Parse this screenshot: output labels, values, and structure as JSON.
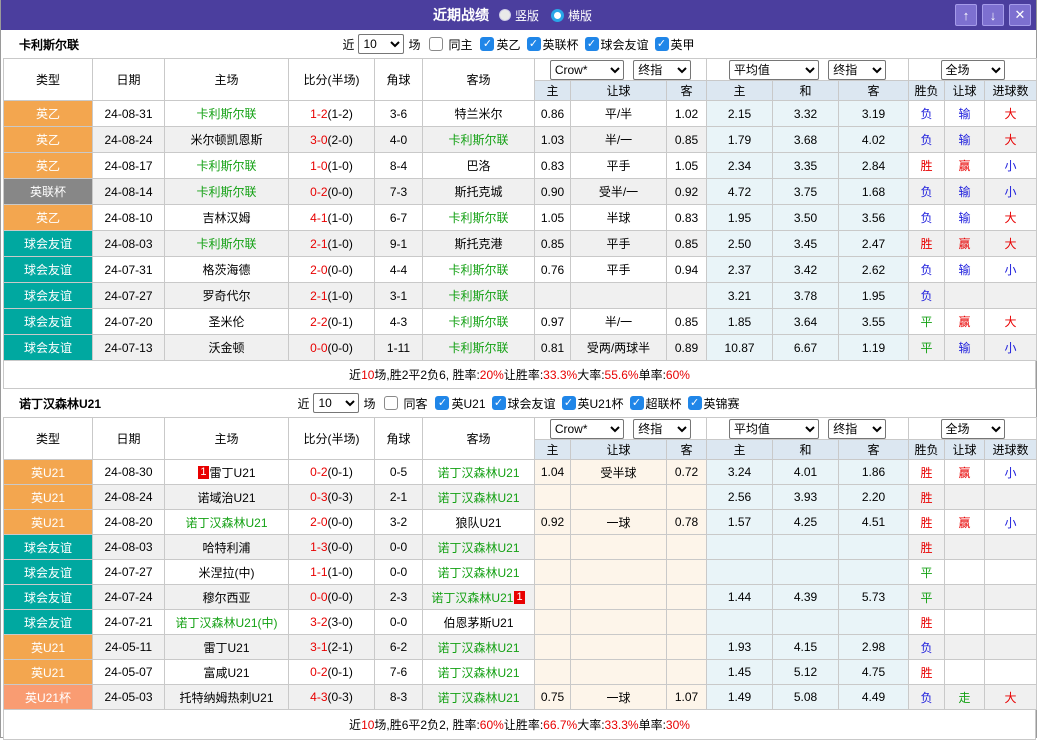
{
  "title_bar": {
    "title": "近期战绩",
    "radio_vertical": "竖版",
    "radio_horizontal": "横版",
    "up_glyph": "↑",
    "down_glyph": "↓",
    "close_glyph": "✕"
  },
  "colors": {
    "accent_purple": "#4b3e9e",
    "badge_orange": "#f3a64f",
    "badge_teal": "#00a8a0",
    "badge_gray": "#878787",
    "badge_salmon": "#f99c72",
    "score_red": "#e80000",
    "result_blue": "#2020dd",
    "result_green": "#14a114",
    "team_green": "#14a114",
    "checkbox_blue": "#2086e8",
    "header_bg": "#dce7f1",
    "avg_col_bg": "#e9f4f8",
    "let_col_bg": "#fdf5ea"
  },
  "odds_controls": {
    "bookmaker": "Crow*",
    "bookmaker_stage": "终指",
    "average": "平均值",
    "average_stage": "终指",
    "scope": "全场"
  },
  "table_header": {
    "type": "类型",
    "date": "日期",
    "home": "主场",
    "score": "比分(半场)",
    "corner": "角球",
    "away": "客场",
    "sub": [
      "主",
      "让球",
      "客",
      "主",
      "和",
      "客",
      "胜负",
      "让球",
      "进球数"
    ]
  },
  "sections": [
    {
      "team": "卡利斯尔联",
      "filter": {
        "prefix": "近",
        "count": "10",
        "suffix": "场",
        "same_label": "同主",
        "leagues": [
          "英乙",
          "英联杯",
          "球会友谊",
          "英甲"
        ]
      },
      "rows": [
        {
          "type": "英乙",
          "tc": "o",
          "date": "24-08-31",
          "home": "卡利斯尔联",
          "hg": 1,
          "hb": "",
          "fs": "1-2",
          "hs": "(1-2)",
          "corner": "3-6",
          "away": "特兰米尔",
          "ag": 0,
          "ab": "",
          "l1": "0.86",
          "l2": "平/半",
          "l3": "1.02",
          "a1": "2.15",
          "a2": "3.32",
          "a3": "3.19",
          "r1": "负",
          "r2": "输",
          "r3": "大"
        },
        {
          "type": "英乙",
          "tc": "o",
          "date": "24-08-24",
          "home": "米尔顿凯恩斯",
          "hg": 0,
          "hb": "",
          "fs": "3-0",
          "hs": "(2-0)",
          "corner": "4-0",
          "away": "卡利斯尔联",
          "ag": 1,
          "ab": "",
          "l1": "1.03",
          "l2": "半/一",
          "l3": "0.85",
          "a1": "1.79",
          "a2": "3.68",
          "a3": "4.02",
          "r1": "负",
          "r2": "输",
          "r3": "大"
        },
        {
          "type": "英乙",
          "tc": "o",
          "date": "24-08-17",
          "home": "卡利斯尔联",
          "hg": 1,
          "hb": "",
          "fs": "1-0",
          "hs": "(1-0)",
          "corner": "8-4",
          "away": "巴洛",
          "ag": 0,
          "ab": "",
          "l1": "0.83",
          "l2": "平手",
          "l3": "1.05",
          "a1": "2.34",
          "a2": "3.35",
          "a3": "2.84",
          "r1": "胜",
          "r2": "赢",
          "r3": "小"
        },
        {
          "type": "英联杯",
          "tc": "g",
          "date": "24-08-14",
          "home": "卡利斯尔联",
          "hg": 1,
          "hb": "",
          "fs": "0-2",
          "hs": "(0-0)",
          "corner": "7-3",
          "away": "斯托克城",
          "ag": 0,
          "ab": "",
          "l1": "0.90",
          "l2": "受半/一",
          "l3": "0.92",
          "a1": "4.72",
          "a2": "3.75",
          "a3": "1.68",
          "r1": "负",
          "r2": "输",
          "r3": "小"
        },
        {
          "type": "英乙",
          "tc": "o",
          "date": "24-08-10",
          "home": "吉林汉姆",
          "hg": 0,
          "hb": "",
          "fs": "4-1",
          "hs": "(1-0)",
          "corner": "6-7",
          "away": "卡利斯尔联",
          "ag": 1,
          "ab": "",
          "l1": "1.05",
          "l2": "半球",
          "l3": "0.83",
          "a1": "1.95",
          "a2": "3.50",
          "a3": "3.56",
          "r1": "负",
          "r2": "输",
          "r3": "大"
        },
        {
          "type": "球会友谊",
          "tc": "t",
          "date": "24-08-03",
          "home": "卡利斯尔联",
          "hg": 1,
          "hb": "",
          "fs": "2-1",
          "hs": "(1-0)",
          "corner": "9-1",
          "away": "斯托克港",
          "ag": 0,
          "ab": "",
          "l1": "0.85",
          "l2": "平手",
          "l3": "0.85",
          "a1": "2.50",
          "a2": "3.45",
          "a3": "2.47",
          "r1": "胜",
          "r2": "赢",
          "r3": "大"
        },
        {
          "type": "球会友谊",
          "tc": "t",
          "date": "24-07-31",
          "home": "格茨海德",
          "hg": 0,
          "hb": "",
          "fs": "2-0",
          "hs": "(0-0)",
          "corner": "4-4",
          "away": "卡利斯尔联",
          "ag": 1,
          "ab": "",
          "l1": "0.76",
          "l2": "平手",
          "l3": "0.94",
          "a1": "2.37",
          "a2": "3.42",
          "a3": "2.62",
          "r1": "负",
          "r2": "输",
          "r3": "小"
        },
        {
          "type": "球会友谊",
          "tc": "t",
          "date": "24-07-27",
          "home": "罗奇代尔",
          "hg": 0,
          "hb": "",
          "fs": "2-1",
          "hs": "(1-0)",
          "corner": "3-1",
          "away": "卡利斯尔联",
          "ag": 1,
          "ab": "",
          "l1": "",
          "l2": "",
          "l3": "",
          "a1": "3.21",
          "a2": "3.78",
          "a3": "1.95",
          "r1": "负",
          "r2": "",
          "r3": ""
        },
        {
          "type": "球会友谊",
          "tc": "t",
          "date": "24-07-20",
          "home": "圣米伦",
          "hg": 0,
          "hb": "",
          "fs": "2-2",
          "hs": "(0-1)",
          "corner": "4-3",
          "away": "卡利斯尔联",
          "ag": 1,
          "ab": "",
          "l1": "0.97",
          "l2": "半/一",
          "l3": "0.85",
          "a1": "1.85",
          "a2": "3.64",
          "a3": "3.55",
          "r1": "平",
          "r2": "赢",
          "r3": "大"
        },
        {
          "type": "球会友谊",
          "tc": "t",
          "date": "24-07-13",
          "home": "沃金顿",
          "hg": 0,
          "hb": "",
          "fs": "0-0",
          "hs": "(0-0)",
          "corner": "1-11",
          "away": "卡利斯尔联",
          "ag": 1,
          "ab": "",
          "l1": "0.81",
          "l2": "受两/两球半",
          "l3": "0.89",
          "a1": "10.87",
          "a2": "6.67",
          "a3": "1.19",
          "r1": "平",
          "r2": "输",
          "r3": "小"
        }
      ],
      "summary": [
        {
          "t": "近"
        },
        {
          "t": "10",
          "r": 1
        },
        {
          "t": "场,胜2平2负6, 胜率:"
        },
        {
          "t": "20%",
          "r": 1
        },
        {
          "t": " 让胜率:"
        },
        {
          "t": "33.3%",
          "r": 1
        },
        {
          "t": " 大率:"
        },
        {
          "t": "55.6%",
          "r": 1
        },
        {
          "t": " 单率:"
        },
        {
          "t": "60%",
          "r": 1
        }
      ]
    },
    {
      "team": "诺丁汉森林U21",
      "filter": {
        "prefix": "近",
        "count": "10",
        "suffix": "场",
        "same_label": "同客",
        "leagues": [
          "英U21",
          "球会友谊",
          "英U21杯",
          "超联杯",
          "英锦赛"
        ]
      },
      "rows": [
        {
          "type": "英U21",
          "tc": "o",
          "date": "24-08-30",
          "home": "雷丁U21",
          "hg": 0,
          "hb": "1",
          "fs": "0-2",
          "hs": "(0-1)",
          "corner": "0-5",
          "away": "诺丁汉森林U21",
          "ag": 1,
          "ab": "",
          "l1": "1.04",
          "l2": "受半球",
          "l3": "0.72",
          "a1": "3.24",
          "a2": "4.01",
          "a3": "1.86",
          "r1": "胜",
          "r2": "赢",
          "r3": "小"
        },
        {
          "type": "英U21",
          "tc": "o",
          "date": "24-08-24",
          "home": "诺域治U21",
          "hg": 0,
          "hb": "",
          "fs": "0-3",
          "hs": "(0-3)",
          "corner": "2-1",
          "away": "诺丁汉森林U21",
          "ag": 1,
          "ab": "",
          "l1": "",
          "l2": "",
          "l3": "",
          "a1": "2.56",
          "a2": "3.93",
          "a3": "2.20",
          "r1": "胜",
          "r2": "",
          "r3": ""
        },
        {
          "type": "英U21",
          "tc": "o",
          "date": "24-08-20",
          "home": "诺丁汉森林U21",
          "hg": 1,
          "hb": "",
          "fs": "2-0",
          "hs": "(0-0)",
          "corner": "3-2",
          "away": "狼队U21",
          "ag": 0,
          "ab": "",
          "l1": "0.92",
          "l2": "一球",
          "l3": "0.78",
          "a1": "1.57",
          "a2": "4.25",
          "a3": "4.51",
          "r1": "胜",
          "r2": "赢",
          "r3": "小"
        },
        {
          "type": "球会友谊",
          "tc": "t",
          "date": "24-08-03",
          "home": "哈特利浦",
          "hg": 0,
          "hb": "",
          "fs": "1-3",
          "hs": "(0-0)",
          "corner": "0-0",
          "away": "诺丁汉森林U21",
          "ag": 1,
          "ab": "",
          "l1": "",
          "l2": "",
          "l3": "",
          "a1": "",
          "a2": "",
          "a3": "",
          "r1": "胜",
          "r2": "",
          "r3": ""
        },
        {
          "type": "球会友谊",
          "tc": "t",
          "date": "24-07-27",
          "home": "米涅拉(中)",
          "hg": 0,
          "hb": "",
          "fs": "1-1",
          "hs": "(1-0)",
          "corner": "0-0",
          "away": "诺丁汉森林U21",
          "ag": 1,
          "ab": "",
          "l1": "",
          "l2": "",
          "l3": "",
          "a1": "",
          "a2": "",
          "a3": "",
          "r1": "平",
          "r2": "",
          "r3": ""
        },
        {
          "type": "球会友谊",
          "tc": "t",
          "date": "24-07-24",
          "home": "穆尔西亚",
          "hg": 0,
          "hb": "",
          "fs": "0-0",
          "hs": "(0-0)",
          "corner": "2-3",
          "away": "诺丁汉森林U21",
          "ag": 1,
          "ab": "1",
          "l1": "",
          "l2": "",
          "l3": "",
          "a1": "1.44",
          "a2": "4.39",
          "a3": "5.73",
          "r1": "平",
          "r2": "",
          "r3": ""
        },
        {
          "type": "球会友谊",
          "tc": "t",
          "date": "24-07-21",
          "home": "诺丁汉森林U21(中)",
          "hg": 1,
          "hb": "",
          "fs": "3-2",
          "hs": "(3-0)",
          "corner": "0-0",
          "away": "伯恩茅斯U21",
          "ag": 0,
          "ab": "",
          "l1": "",
          "l2": "",
          "l3": "",
          "a1": "",
          "a2": "",
          "a3": "",
          "r1": "胜",
          "r2": "",
          "r3": ""
        },
        {
          "type": "英U21",
          "tc": "o",
          "date": "24-05-11",
          "home": "雷丁U21",
          "hg": 0,
          "hb": "",
          "fs": "3-1",
          "hs": "(2-1)",
          "corner": "6-2",
          "away": "诺丁汉森林U21",
          "ag": 1,
          "ab": "",
          "l1": "",
          "l2": "",
          "l3": "",
          "a1": "1.93",
          "a2": "4.15",
          "a3": "2.98",
          "r1": "负",
          "r2": "",
          "r3": ""
        },
        {
          "type": "英U21",
          "tc": "o",
          "date": "24-05-07",
          "home": "富咸U21",
          "hg": 0,
          "hb": "",
          "fs": "0-2",
          "hs": "(0-1)",
          "corner": "7-6",
          "away": "诺丁汉森林U21",
          "ag": 1,
          "ab": "",
          "l1": "",
          "l2": "",
          "l3": "",
          "a1": "1.45",
          "a2": "5.12",
          "a3": "4.75",
          "r1": "胜",
          "r2": "",
          "r3": ""
        },
        {
          "type": "英U21杯",
          "tc": "s",
          "date": "24-05-03",
          "home": "托特纳姆热刺U21",
          "hg": 0,
          "hb": "",
          "fs": "4-3",
          "hs": "(0-3)",
          "corner": "8-3",
          "away": "诺丁汉森林U21",
          "ag": 1,
          "ab": "",
          "l1": "0.75",
          "l2": "一球",
          "l3": "1.07",
          "a1": "1.49",
          "a2": "5.08",
          "a3": "4.49",
          "r1": "负",
          "r2": "走",
          "r3": "大"
        }
      ],
      "summary": [
        {
          "t": "近"
        },
        {
          "t": "10",
          "r": 1
        },
        {
          "t": "场,胜6平2负2, 胜率:"
        },
        {
          "t": "60%",
          "r": 1
        },
        {
          "t": " 让胜率:"
        },
        {
          "t": "66.7%",
          "r": 1
        },
        {
          "t": " 大率:"
        },
        {
          "t": "33.3%",
          "r": 1
        },
        {
          "t": " 单率:"
        },
        {
          "t": "30%",
          "r": 1
        }
      ]
    }
  ]
}
